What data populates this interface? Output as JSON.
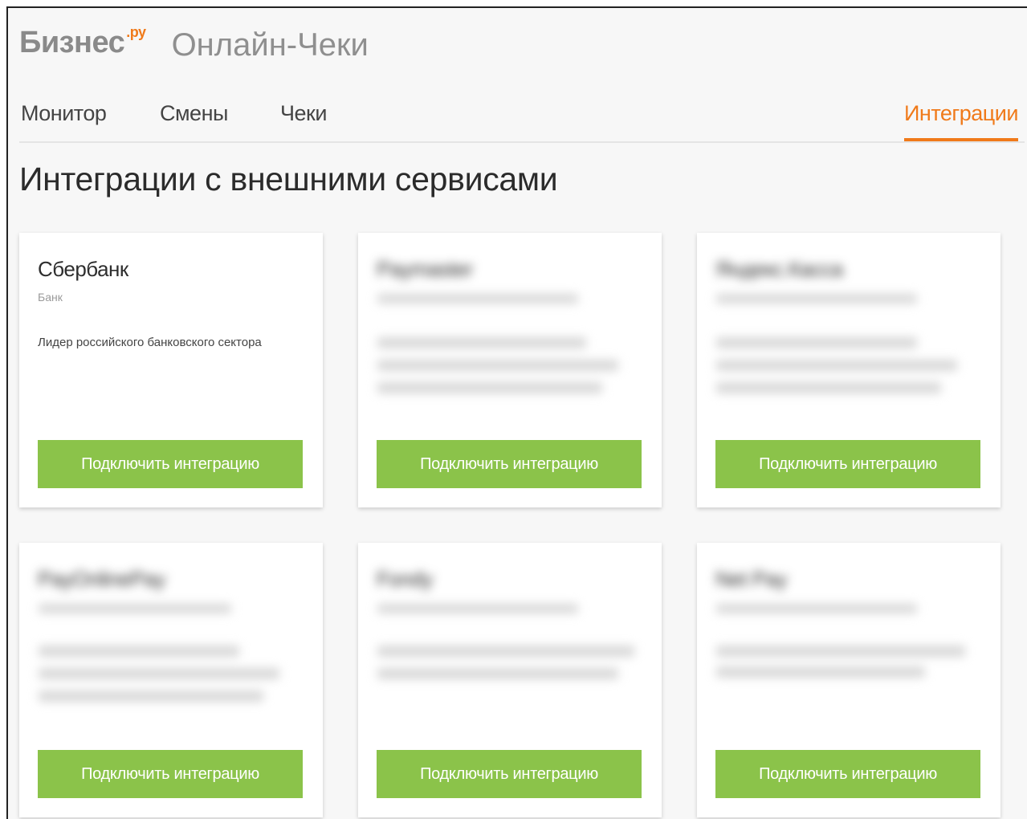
{
  "header": {
    "logo_text": "Бизнес",
    "logo_suffix": ".ру",
    "app_title": "Онлайн-Чеки"
  },
  "tabs": [
    {
      "label": "Монитор",
      "active": false
    },
    {
      "label": "Смены",
      "active": false
    },
    {
      "label": "Чеки",
      "active": false
    },
    {
      "label": "Интеграции",
      "active": true
    }
  ],
  "page_title": "Интеграции с внешними сервисами",
  "cards": [
    {
      "title": "Сбербанк",
      "subtitle": "Банк",
      "description": "Лидер российского банковского сектора",
      "button_label": "Подключить интеграцию",
      "blurred": false
    },
    {
      "title": "Paymaster",
      "subtitle": "",
      "description": "",
      "button_label": "Подключить интеграцию",
      "blurred": true
    },
    {
      "title": "Яндекс.Касса",
      "subtitle": "",
      "description": "",
      "button_label": "Подключить интеграцию",
      "blurred": true
    },
    {
      "title": "PayOnlinePay",
      "subtitle": "",
      "description": "",
      "button_label": "Подключить интеграцию",
      "blurred": true
    },
    {
      "title": "Fondy",
      "subtitle": "",
      "description": "",
      "button_label": "Подключить интеграцию",
      "blurred": true
    },
    {
      "title": "Net Pay",
      "subtitle": "",
      "description": "",
      "button_label": "Подключить интеграцию",
      "blurred": true
    }
  ],
  "colors": {
    "accent": "#f07a1a",
    "button": "#8bc34a",
    "background": "#f7f7f7"
  }
}
